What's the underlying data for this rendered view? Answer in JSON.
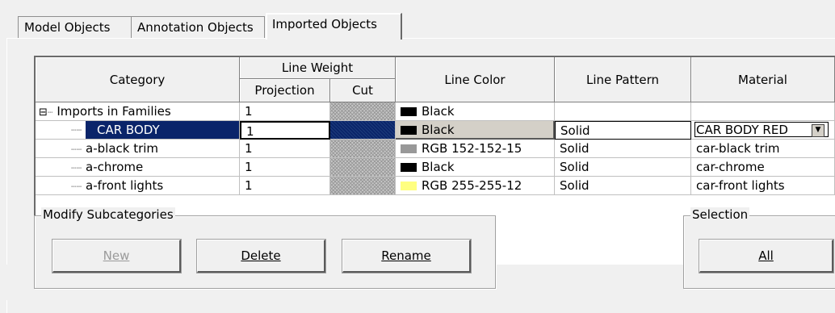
{
  "tabs": [
    {
      "label": "Model Objects"
    },
    {
      "label": "Annotation Objects"
    },
    {
      "label": "Imported Objects",
      "active": true
    }
  ],
  "table": {
    "headers": {
      "category": "Category",
      "line_weight": "Line Weight",
      "projection": "Projection",
      "cut": "Cut",
      "line_color": "Line Color",
      "line_pattern": "Line Pattern",
      "material": "Material"
    },
    "rows": [
      {
        "name": "Imports in Families",
        "projection": "1",
        "color_label": "Black",
        "color": "#000000",
        "pattern": "",
        "material": "",
        "expander": "⊟",
        "parent": true
      },
      {
        "name": "CAR BODY",
        "projection": "1",
        "color_label": "Black",
        "color": "#000000",
        "pattern": "Solid",
        "material": "CAR BODY RED",
        "selected": true
      },
      {
        "name": "a-black trim",
        "projection": "1",
        "color_label": "RGB 152-152-15",
        "color": "#989898",
        "pattern": "Solid",
        "material": "car-black trim"
      },
      {
        "name": "a-chrome",
        "projection": "1",
        "color_label": "Black",
        "color": "#000000",
        "pattern": "Solid",
        "material": "car-chrome"
      },
      {
        "name": "a-front lights",
        "projection": "1",
        "color_label": "RGB 255-255-12",
        "color": "#ffff80",
        "pattern": "Solid",
        "material": "car-front lights"
      }
    ]
  },
  "modify": {
    "title": "Modify Subcategories",
    "new_label": "New",
    "delete_label": "Delete",
    "rename_label": "Rename"
  },
  "selection": {
    "title": "Selection",
    "all_label": "All"
  },
  "colors": {
    "selection_bg": "#0a246a",
    "window_bg": "#f0f0f0"
  }
}
